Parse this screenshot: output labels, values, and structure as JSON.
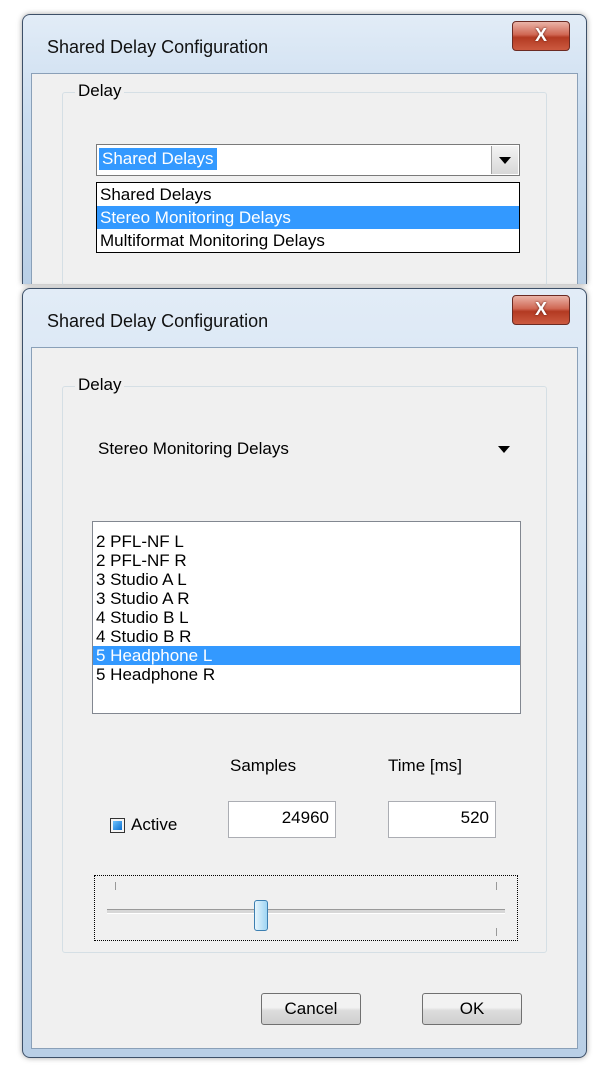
{
  "dialog_top": {
    "title": "Shared Delay Configuration",
    "close_label": "X",
    "group_label": "Delay",
    "combo_selected": "Shared Delays",
    "dropdown_items": [
      "Shared Delays",
      "Stereo Monitoring Delays",
      "Multiformat Monitoring Delays"
    ],
    "highlighted_index": 1
  },
  "dialog_bottom": {
    "title": "Shared Delay Configuration",
    "close_label": "X",
    "group_label": "Delay",
    "combo_value": "Stereo Monitoring Delays",
    "list_items": [
      "2 PFL-NF L",
      "2 PFL-NF R",
      "3 Studio A L",
      "3 Studio A R",
      "4 Studio B L",
      "4 Studio B R",
      "5 Headphone L",
      "5 Headphone R"
    ],
    "selected_index": 6,
    "samples_label": "Samples",
    "time_label": "Time [ms]",
    "active_label": "Active",
    "active_checked": true,
    "samples_value": "24960",
    "time_value": "520",
    "slider_level": 0.38,
    "cancel_label": "Cancel",
    "ok_label": "OK"
  },
  "colors": {
    "selection": "#3399ff",
    "close_button": "#c7503a",
    "frame": "#c9dcef"
  }
}
